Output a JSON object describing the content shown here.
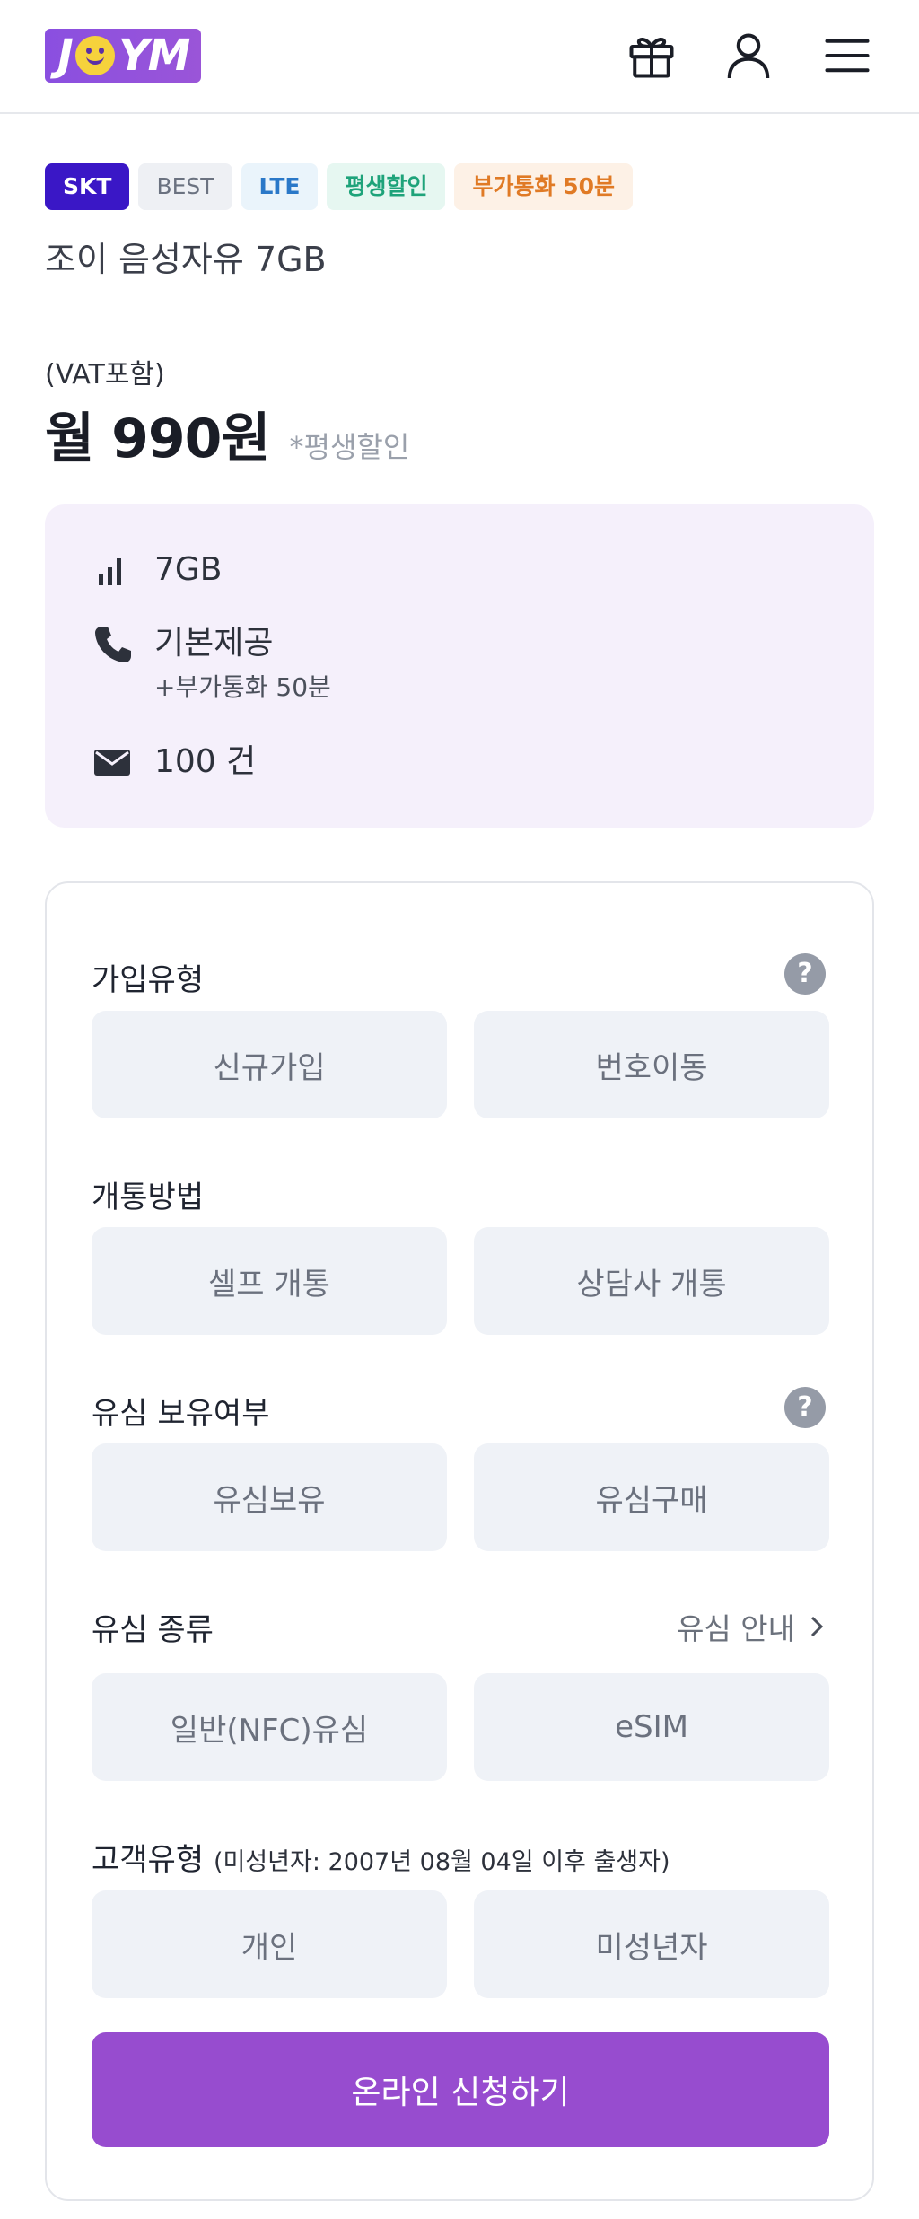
{
  "header": {
    "logo_text": "JOYM",
    "gift_icon": "gift-icon",
    "user_icon": "user-icon",
    "menu_icon": "menu-icon"
  },
  "tags": [
    {
      "label": "SKT",
      "bg": "#3a17c6",
      "color": "#ffffff"
    },
    {
      "label": "BEST",
      "bg": "#eef0f4",
      "color": "#6b7280"
    },
    {
      "label": "LTE",
      "bg": "#eaf4fb",
      "color": "#2a78c8"
    },
    {
      "label": "평생할인",
      "bg": "#e6f7f1",
      "color": "#1ea37a"
    },
    {
      "label": "부가통화 50분",
      "bg": "#fdf1e6",
      "color": "#e07a25"
    }
  ],
  "plan": {
    "title": "조이 음성자유 7GB",
    "vat": "(VAT포함)",
    "price": "월 990원",
    "price_note": "*평생할인"
  },
  "specs": {
    "data": "7GB",
    "call": "기본제공",
    "call_extra": "+부가통화 50분",
    "sms": "100 건"
  },
  "form": {
    "join_type": {
      "label": "가입유형",
      "options": [
        "신규가입",
        "번호이동"
      ]
    },
    "activation": {
      "label": "개통방법",
      "options": [
        "셀프 개통",
        "상담사 개통"
      ]
    },
    "sim_own": {
      "label": "유심 보유여부",
      "options": [
        "유심보유",
        "유심구매"
      ]
    },
    "sim_type": {
      "label": "유심 종류",
      "guide": "유심 안내",
      "options": [
        "일반(NFC)유심",
        "eSIM"
      ]
    },
    "customer": {
      "label": "고객유형",
      "note": "(미성년자: 2007년 08월 04일 이후 출생자)",
      "options": [
        "개인",
        "미성년자"
      ]
    },
    "help_glyph": "?",
    "submit": "온라인 신청하기"
  },
  "colors": {
    "accent": "#974ccf",
    "brand": "#8a4fe0",
    "spec_bg": "#f5f0fb"
  }
}
